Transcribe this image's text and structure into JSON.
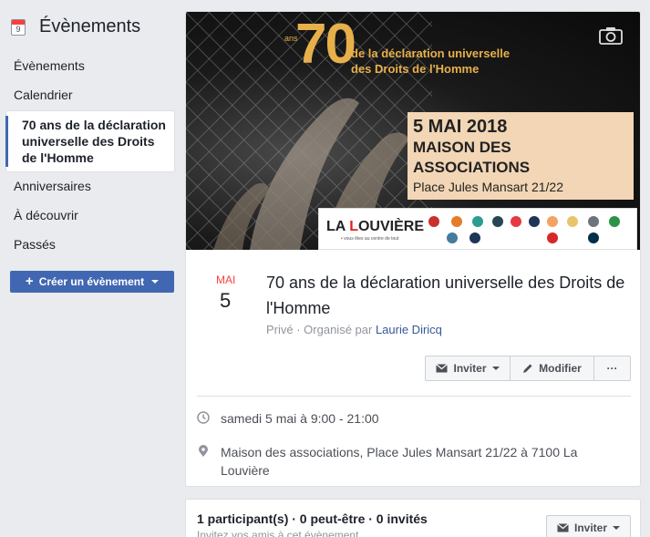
{
  "sidebar": {
    "calendar_day": "9",
    "title": "Évènements",
    "items": [
      {
        "label": "Évènements"
      },
      {
        "label": "Calendrier"
      },
      {
        "label": "70 ans de la déclaration universelle des Droits de l'Homme"
      },
      {
        "label": "Anniversaires"
      },
      {
        "label": "À découvrir"
      },
      {
        "label": "Passés"
      }
    ],
    "create_label": "Créer un évènement"
  },
  "cover": {
    "big_number": "70",
    "ans": "ans",
    "line1": "de la déclaration universelle",
    "line2": "des Droits de l'Homme",
    "date": "5 MAI 2018",
    "venue": "MAISON DES ASSOCIATIONS",
    "address": "Place Jules Mansart 21/22",
    "logo_text_a": "LA ",
    "logo_text_b": "L",
    "logo_text_c": "OUVIÈRE",
    "logo_sub": "• vous êtes au centre de tout",
    "accent": "#e8b04a"
  },
  "event": {
    "month": "MAI",
    "day": "5",
    "title": "70 ans de la déclaration universelle des Droits de l'Homme",
    "privacy": "Privé · Organisé par ",
    "organizer": "Laurie Diricq",
    "invite_label": "Inviter",
    "edit_label": "Modifier",
    "more_label": "···",
    "time": "samedi 5 mai à 9:00 - 21:00",
    "location": "Maison des associations, Place Jules Mansart 21/22 à 7100 La Louvière"
  },
  "guests": {
    "summary": "1 participant(s) · 0 peut-être · 0 invités",
    "hint": "Invitez vos amis à cet évènement",
    "invite_label": "Inviter"
  },
  "colors": {
    "brand": "#4267b2",
    "month_red": "#fa3e3e",
    "link": "#365899"
  }
}
